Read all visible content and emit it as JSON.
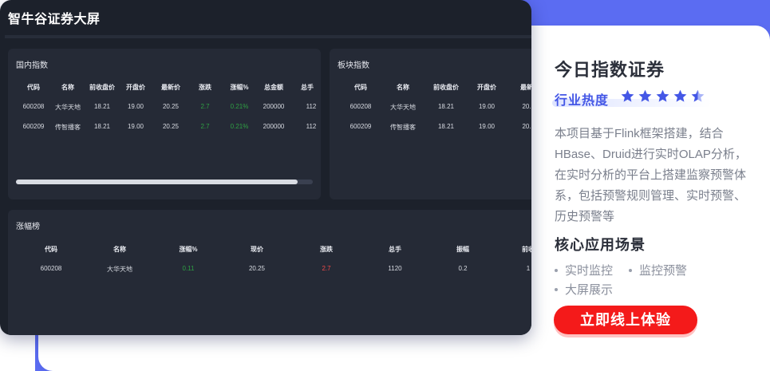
{
  "dashboard": {
    "title": "智牛谷证券大屏",
    "domestic": {
      "title": "国内指数",
      "headers": [
        "代码",
        "名称",
        "前收盘价",
        "开盘价",
        "最新价",
        "涨跌",
        "涨幅%",
        "总金额",
        "总手"
      ],
      "rows": [
        [
          "600208",
          "大华天地",
          "18.21",
          "19.00",
          "20.25",
          "2.7",
          "0.21%",
          "200000",
          "112"
        ],
        [
          "600209",
          "传智播客",
          "18.21",
          "19.00",
          "20.25",
          "2.7",
          "0.21%",
          "200000",
          "112"
        ]
      ],
      "scroll_fraction": 0.95
    },
    "sector": {
      "title": "板块指数",
      "headers": [
        "代码",
        "名称",
        "前收盘价",
        "开盘价",
        "最新"
      ],
      "rows": [
        [
          "600208",
          "大华天地",
          "18.21",
          "19.00",
          "20."
        ],
        [
          "600209",
          "传智播客",
          "18.21",
          "19.00",
          "20."
        ]
      ]
    },
    "gainers": {
      "title": "涨幅榜",
      "headers": [
        "代码",
        "名称",
        "涨幅%",
        "现价",
        "涨跌",
        "总手",
        "振幅",
        "前收"
      ],
      "rows": [
        [
          "600208",
          "大华天地",
          "0.11",
          "20.25",
          "2.7",
          "1120",
          "0.2",
          "1"
        ]
      ]
    }
  },
  "info": {
    "title": "今日指数证券",
    "heat_label": "行业热度",
    "rating": 4.5,
    "rating_max": 5,
    "description": "本项目基于Flink框架搭建，结合HBase、Druid进行实时OLAP分析，在实时分析的平台上搭建监察预警体系，包括预警规则管理、实时预警、历史预警等",
    "scenes_title": "核心应用场景",
    "scenes": [
      "实时监控",
      "监控预警",
      "大屏展示"
    ],
    "cta_label": "立即线上体验"
  },
  "colors": {
    "accent_blue": "#5b6cf2",
    "star_blue": "#4457e6",
    "cta_red": "#f41a1a",
    "up_green": "#2ea043",
    "up_red": "#f04a4a"
  },
  "icons": [
    "star-icon"
  ]
}
